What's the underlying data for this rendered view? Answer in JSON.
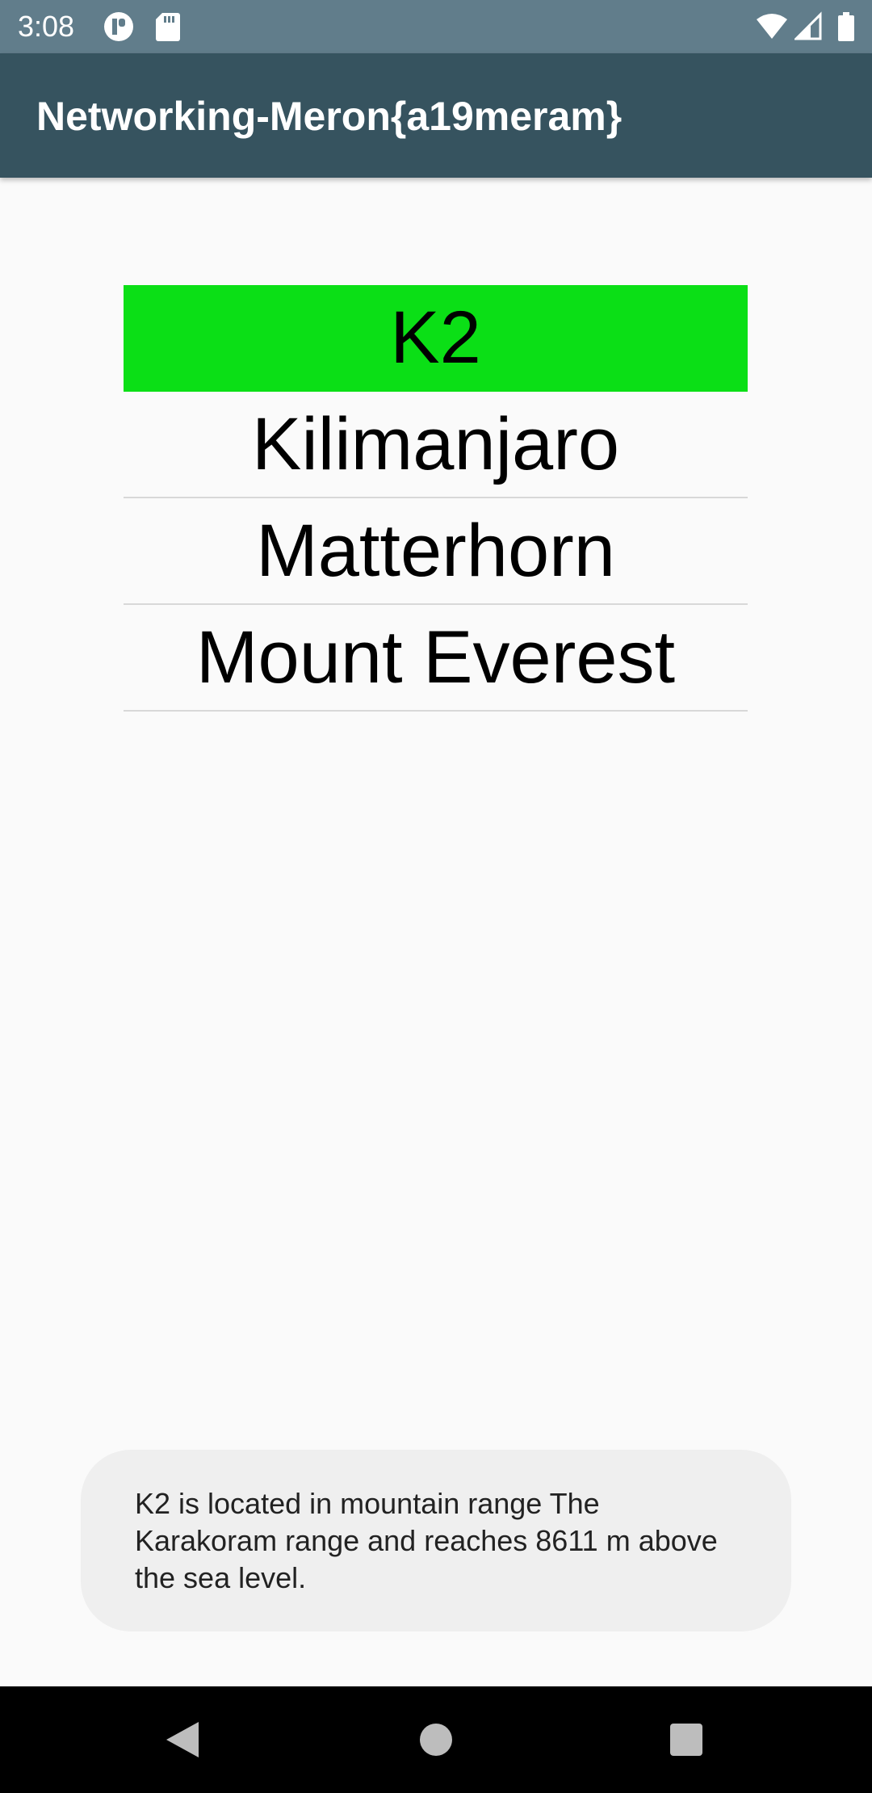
{
  "status_bar": {
    "time": "3:08",
    "icons": [
      "app-notification-icon",
      "sd-card-icon",
      "wifi-icon",
      "cell-signal-icon",
      "battery-icon"
    ],
    "background_color": "#617d8b"
  },
  "app_bar": {
    "title": "Networking-Meron{a19meram}",
    "background_color": "#36535f"
  },
  "mountains": {
    "items": [
      {
        "name": "K2",
        "selected": true
      },
      {
        "name": "Kilimanjaro",
        "selected": false
      },
      {
        "name": "Matterhorn",
        "selected": false
      },
      {
        "name": "Mount Everest",
        "selected": false
      }
    ],
    "selected_color": "#0bdf16"
  },
  "toast": {
    "message": "K2 is located in mountain range The Karakoram range and reaches 8611 m above the sea level."
  },
  "nav_bar": {
    "buttons": [
      "back-icon",
      "home-icon",
      "recents-icon"
    ]
  }
}
